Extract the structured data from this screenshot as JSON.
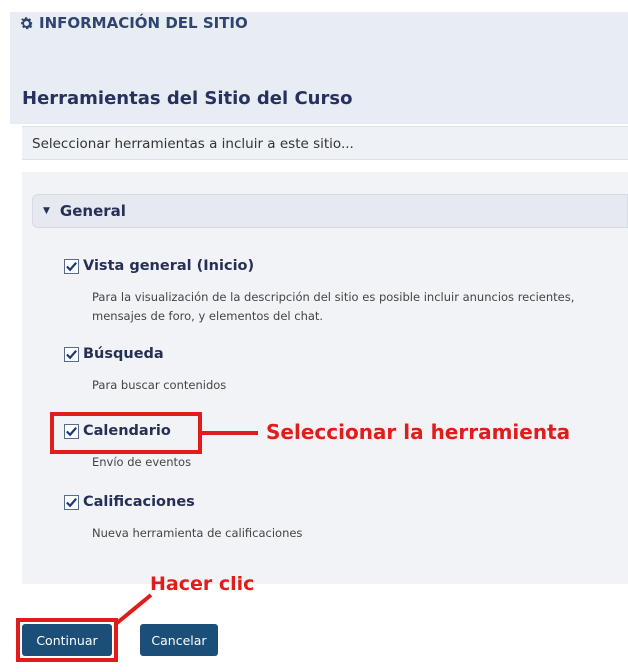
{
  "site": {
    "title": "INFORMACIÓN DEL SITIO",
    "icon": "gear-icon"
  },
  "page": {
    "heading": "Herramientas del Sitio del Curso",
    "instruction": "Seleccionar herramientas a incluir a este sitio..."
  },
  "group": {
    "label": "General",
    "expanded": true
  },
  "tools": [
    {
      "label": "Vista general (Inicio)",
      "checked": true,
      "description": "Para la visualización de la descripción del sitio es posible incluir anuncios recientes, mensajes de foro, y elementos del chat."
    },
    {
      "label": "Búsqueda",
      "checked": true,
      "description": "Para buscar contenidos"
    },
    {
      "label": "Calendario",
      "checked": true,
      "description": "Envío de eventos"
    },
    {
      "label": "Calificaciones",
      "checked": true,
      "description": "Nueva herramienta de calificaciones"
    }
  ],
  "buttons": {
    "continue": "Continuar",
    "cancel": "Cancelar"
  },
  "annotations": {
    "select_tool": "Seleccionar la herramienta",
    "click": "Hacer clic",
    "color": "#e21b1b"
  },
  "colors": {
    "header_bg": "#e8edf3",
    "heading": "#263160",
    "button_bg": "#1b4f7a"
  }
}
